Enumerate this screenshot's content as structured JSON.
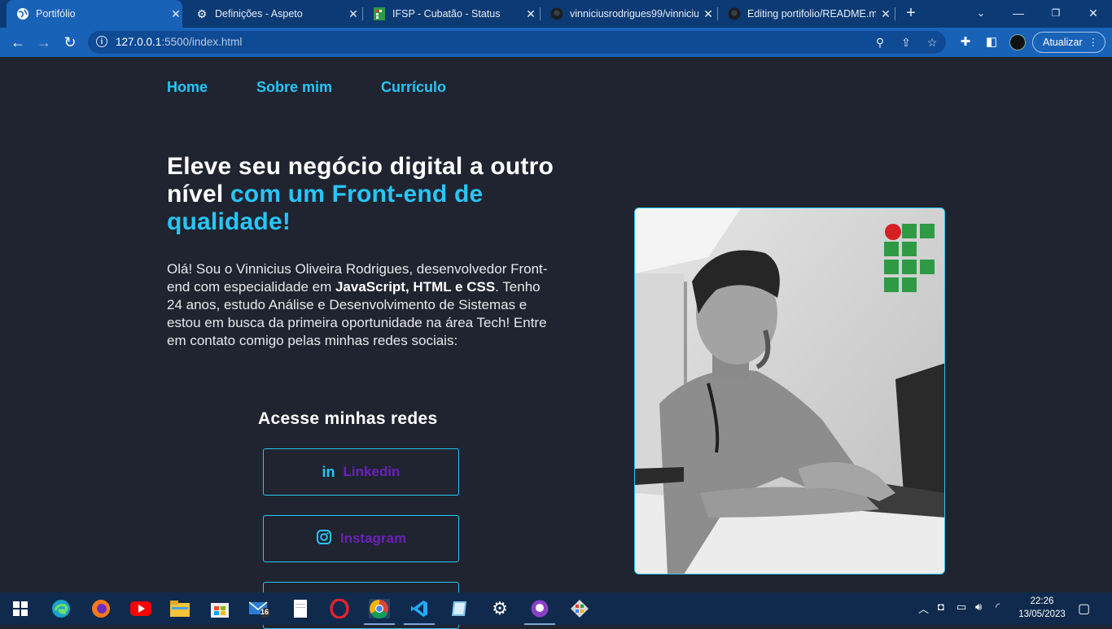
{
  "browser": {
    "tabs": [
      {
        "title": "Portifólio",
        "icon": "globe-icon",
        "active": true
      },
      {
        "title": "Definições - Aspeto",
        "icon": "gear-icon",
        "active": false
      },
      {
        "title": "IFSP - Cubatão - Status",
        "icon": "ifsp-icon",
        "active": false
      },
      {
        "title": "vinniciusrodrigues99/vinniciu",
        "icon": "github-icon",
        "active": false
      },
      {
        "title": "Editing portifolio/README.m",
        "icon": "github-icon",
        "active": false
      }
    ],
    "url_host": "127.0.0.1",
    "url_rest": ":5500/index.html",
    "update_label": "Atualizar"
  },
  "page": {
    "nav": [
      "Home",
      "Sobre mim",
      "Currículo"
    ],
    "headline_white": "Eleve seu negócio digital a outro nível ",
    "headline_accent": "com um Front-end de qualidade!",
    "bio_part1": "Olá! Sou o Vinnicius Oliveira Rodrigues, desenvolvedor Front-end com especialidade em ",
    "bio_bold": "JavaScript, HTML e CSS",
    "bio_part2": ". Tenho 24 anos, estudo Análise e Desenvolvimento de Sistemas e estou em busca da primeira oportunidade na área Tech! Entre em contato comigo pelas minhas redes sociais:",
    "social_title": "Acesse minhas redes",
    "social_buttons": [
      {
        "label": "Linkedin",
        "icon": "linkedin-icon"
      },
      {
        "label": "Instagram",
        "icon": "instagram-icon"
      },
      {
        "label": "",
        "icon": ""
      }
    ],
    "colors": {
      "background": "#1f2430",
      "accent": "#29c5f6",
      "button_text": "#6a22b8"
    }
  },
  "taskbar": {
    "mail_badge": "16",
    "time": "22:26",
    "date": "13/05/2023"
  }
}
